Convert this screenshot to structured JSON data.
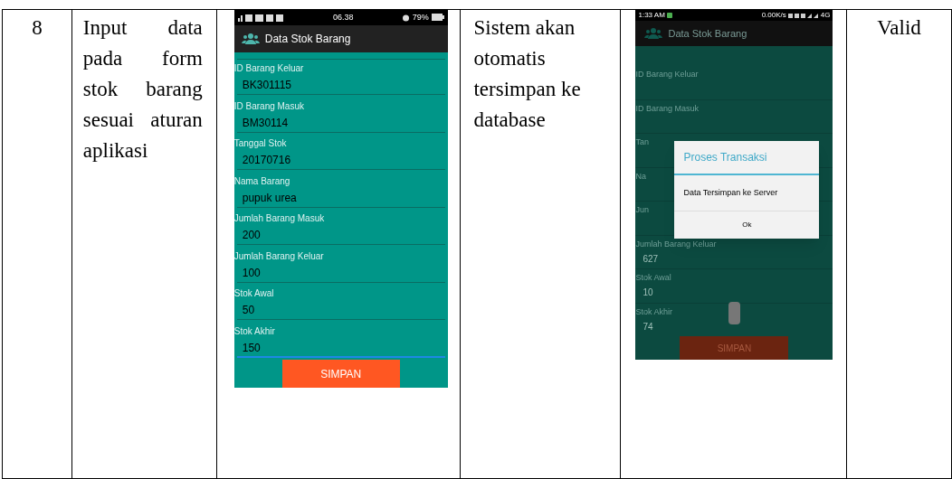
{
  "table": {
    "row": {
      "number": "8",
      "scenario": "Input data pada form stok barang sesuai aturan aplikasi",
      "expected": "Sistem akan otomatis tersimpan ke database",
      "result": "Valid"
    }
  },
  "screenshot_input": {
    "status_bar": {
      "time": "06.38",
      "battery": "79%"
    },
    "app_bar": {
      "title": "Data Stok Barang"
    },
    "fields": [
      {
        "label": "ID Barang Keluar",
        "value": "BK301115"
      },
      {
        "label": "ID Barang Masuk",
        "value": "BM30114"
      },
      {
        "label": "Tanggal Stok",
        "value": "20170716"
      },
      {
        "label": "Nama Barang",
        "value": "pupuk urea"
      },
      {
        "label": "Jumlah Barang Masuk",
        "value": "200"
      },
      {
        "label": "Jumlah Barang Keluar",
        "value": "100"
      },
      {
        "label": "Stok Awal",
        "value": "50"
      },
      {
        "label": "Stok Akhir",
        "value": "150"
      }
    ],
    "button": "SIMPAN"
  },
  "screenshot_result": {
    "status_bar": {
      "time": "1:33 AM",
      "speed": "0.00K/s",
      "network": "4G"
    },
    "app_bar": {
      "title": "Data Stok Barang"
    },
    "fields": [
      {
        "label": "ID Barang Keluar"
      },
      {
        "label": "ID Barang Masuk"
      },
      {
        "label": "Tan"
      },
      {
        "label": "Na"
      },
      {
        "label": "Jun"
      },
      {
        "label": "Jumlah Barang Keluar",
        "value": "627"
      },
      {
        "label": "Stok Awal",
        "value": "10"
      },
      {
        "label": "Stok Akhir",
        "value": "74"
      }
    ],
    "button": "SIMPAN",
    "dialog": {
      "title": "Proses Transaksi",
      "message": "Data Tersimpan ke Server",
      "button": "Ok"
    }
  }
}
